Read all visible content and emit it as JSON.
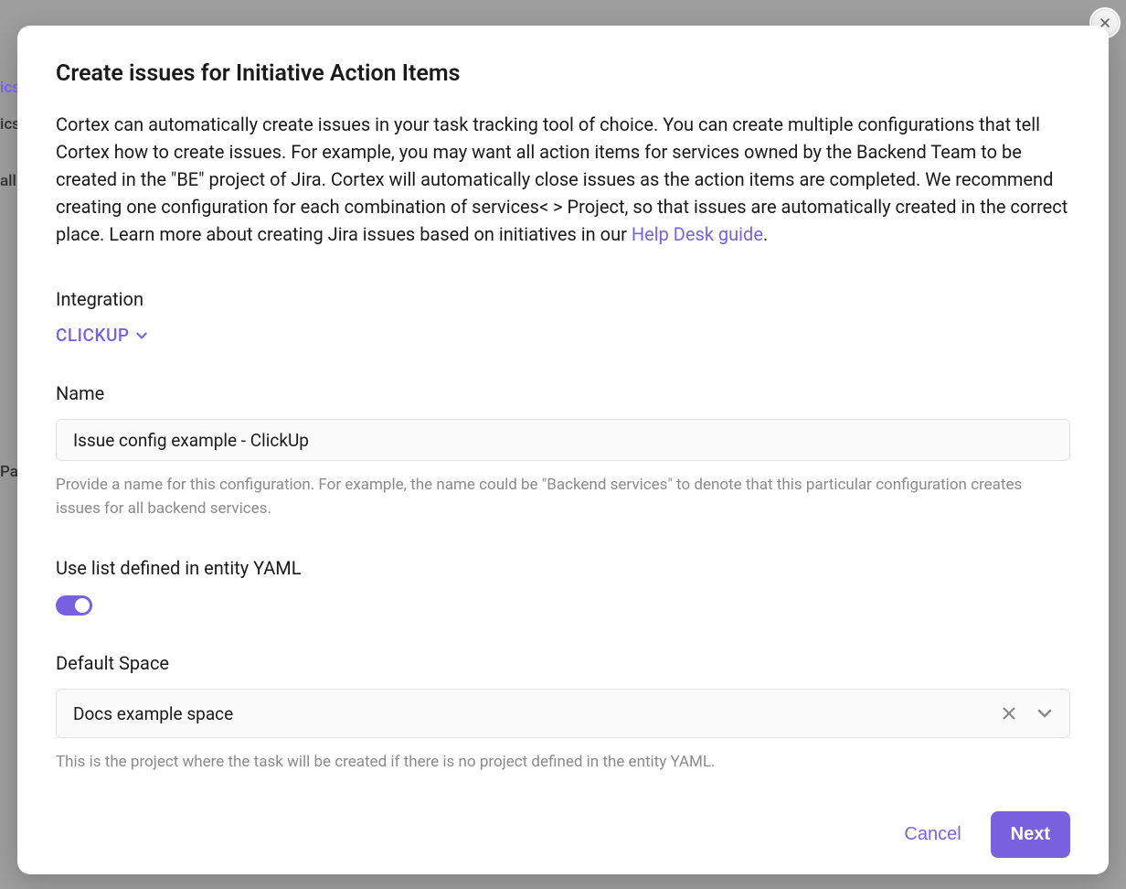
{
  "background": {
    "side_text_1": "ics",
    "side_text_2": "ics",
    "side_text_3": "all s",
    "side_text_4": "Pas"
  },
  "modal": {
    "title": "Create issues for Initiative Action Items",
    "description_part_1": "Cortex can automatically create issues in your task tracking tool of choice. You can create multiple configurations that tell Cortex how to create issues. For example, you may want all action items for services owned by the Backend Team to be created in the \"BE\" project of Jira. Cortex will automatically close issues as the action items are completed. We recommend creating one configuration for each combination of services< > Project, so that issues are automatically created in the correct place. Learn more about creating Jira issues based on initiatives in our ",
    "help_link_text": "Help Desk guide",
    "description_end": ".",
    "integration_label": "Integration",
    "integration_value": "CLICKUP",
    "name_label": "Name",
    "name_value": "Issue config example - ClickUp",
    "name_helper": "Provide a name for this configuration. For example, the name could be \"Backend services\" to denote that this particular configuration creates issues for all backend services.",
    "yaml_label": "Use list defined in entity YAML",
    "yaml_toggle_on": true,
    "default_space_label": "Default Space",
    "default_space_value": "Docs example space",
    "default_space_helper": "This is the project where the task will be created if there is no project defined in the entity YAML.",
    "cancel_label": "Cancel",
    "next_label": "Next"
  }
}
